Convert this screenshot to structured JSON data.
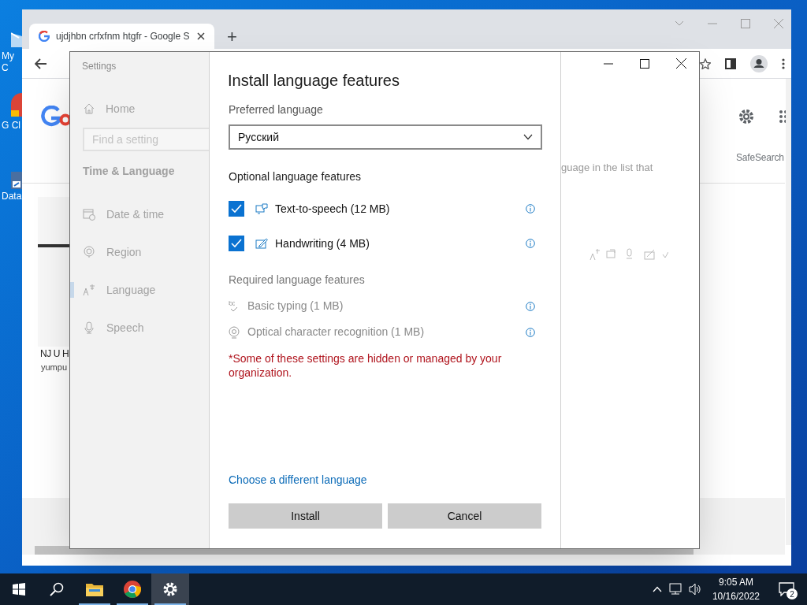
{
  "desktop_icons": [
    {
      "label": "My C"
    },
    {
      "label": "G Cl"
    },
    {
      "label": "Data"
    }
  ],
  "browser": {
    "tabs": [
      {
        "title": "ujdjhbn crfxfnm htgfr - Google S",
        "selected": true
      }
    ],
    "new_tab": "+",
    "page": {
      "result_title": "NJ U H",
      "result_source": "yumpu",
      "safesearch": "SafeSearch"
    }
  },
  "settings": {
    "title": "Settings",
    "home": "Home",
    "search": {
      "placeholder": "Find a setting"
    },
    "section": "Time & Language",
    "nav": [
      {
        "label": "Date & time",
        "selected": false
      },
      {
        "label": "Region",
        "selected": false
      },
      {
        "label": "Language",
        "selected": true
      },
      {
        "label": "Speech",
        "selected": false
      }
    ],
    "background_text": "guage in the list that"
  },
  "dialog": {
    "title": "Install language features",
    "preferred_label": "Preferred language",
    "preferred_value": "Русский",
    "optional_heading": "Optional language features",
    "optional": [
      {
        "label": "Text-to-speech (12 MB)",
        "checked": true
      },
      {
        "label": "Handwriting (4 MB)",
        "checked": true
      }
    ],
    "required_heading": "Required language features",
    "required": [
      {
        "label": "Basic typing (1 MB)"
      },
      {
        "label": "Optical character recognition (1 MB)"
      }
    ],
    "warning": "*Some of these settings are hidden or managed by your organization.",
    "link": "Choose a different language",
    "buttons": [
      "Install",
      "Cancel"
    ]
  },
  "taskbar": {
    "apps": [
      {
        "kind": "start",
        "running": false,
        "selected": false
      },
      {
        "kind": "search",
        "running": false,
        "selected": false
      },
      {
        "kind": "explorer",
        "running": true,
        "selected": false
      },
      {
        "kind": "chrome",
        "running": true,
        "selected": false
      },
      {
        "kind": "settings",
        "running": true,
        "selected": true
      }
    ],
    "time": "9:05 AM",
    "date": "10/16/2022",
    "notifications": "2"
  }
}
